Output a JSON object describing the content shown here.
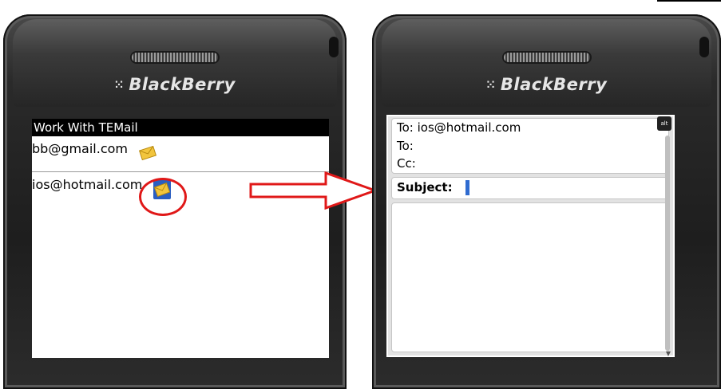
{
  "brand": {
    "logo_glyph": "⁙",
    "name": "BlackBerry"
  },
  "left_screen": {
    "title": "Work With TEMail",
    "contacts": [
      {
        "address": "bb@gmail.com",
        "icon": "envelope-icon"
      },
      {
        "address": "ios@hotmail.com",
        "icon": "envelope-icon",
        "highlighted": true
      }
    ]
  },
  "right_screen": {
    "to_label": "To:",
    "to_value": "ios@hotmail.com",
    "to2_label": "To:",
    "cc_label": "Cc:",
    "subject_label": "Subject:",
    "alt_indicator": "alt",
    "scroll_arrow": "▼"
  },
  "colors": {
    "highlight": "#e01818",
    "cursor": "#2f6bd0",
    "envelope": "#f2c53d"
  }
}
